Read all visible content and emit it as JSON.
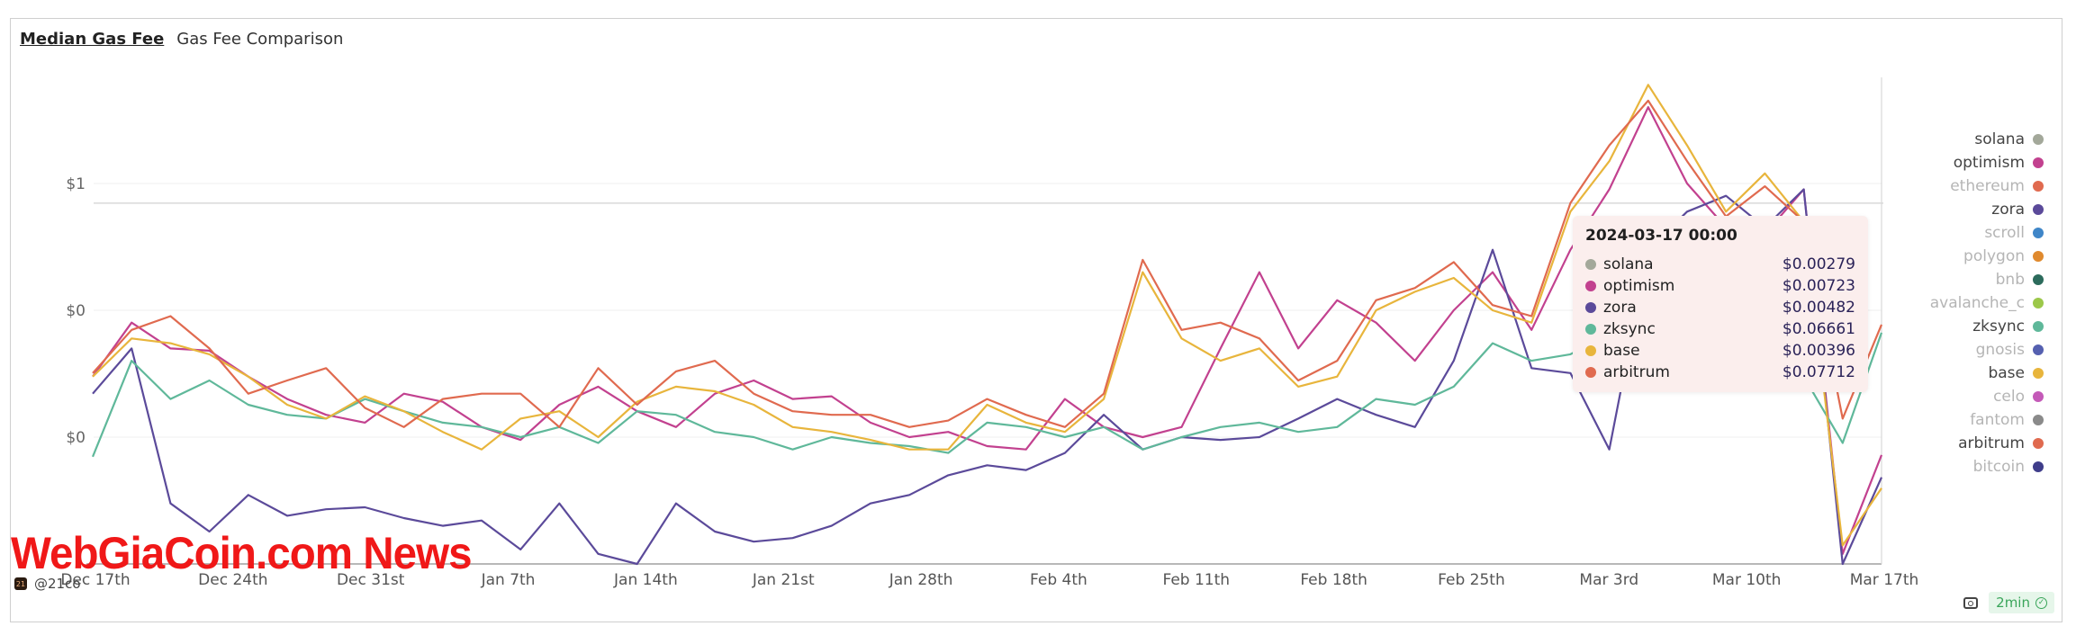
{
  "header": {
    "title": "Median Gas Fee",
    "subtitle": "Gas Fee Comparison"
  },
  "chart_data": {
    "type": "line",
    "title": "Median Gas Fee",
    "subtitle": "Gas Fee Comparison",
    "xlabel": "",
    "ylabel": "",
    "yscale": "log",
    "ylim": [
      0.001,
      6
    ],
    "y_ticks": [
      {
        "value": 1,
        "label": "$1"
      },
      {
        "value": 0.1,
        "label": "$0"
      },
      {
        "value": 0.01,
        "label": "$0"
      }
    ],
    "reference_line_value": 0.7,
    "x_ticks": [
      "Dec 17th",
      "Dec 24th",
      "Dec 31st",
      "Jan 7th",
      "Jan 14th",
      "Jan 21st",
      "Jan 28th",
      "Feb 4th",
      "Feb 11th",
      "Feb 18th",
      "Feb 25th",
      "Mar 3rd",
      "Mar 10th",
      "Mar 17th"
    ],
    "x_start": "2023-12-17",
    "x_end": "2024-03-17",
    "x_step_days": 2,
    "grid": true,
    "legend_position": "right",
    "series": [
      {
        "name": "optimism",
        "color": "#c2418f",
        "values": [
          0.03,
          0.08,
          0.05,
          0.048,
          0.03,
          0.02,
          0.015,
          0.013,
          0.022,
          0.019,
          0.012,
          0.0095,
          0.018,
          0.025,
          0.016,
          0.012,
          0.022,
          0.028,
          0.02,
          0.021,
          0.013,
          0.01,
          0.011,
          0.0085,
          0.008,
          0.02,
          0.012,
          0.01,
          0.012,
          0.05,
          0.2,
          0.05,
          0.12,
          0.08,
          0.04,
          0.1,
          0.2,
          0.07,
          0.3,
          0.9,
          4.0,
          1.0,
          0.45,
          0.4,
          0.9,
          0.0012,
          0.00723
        ]
      },
      {
        "name": "zora",
        "color": "#5b4a9a",
        "values": [
          0.022,
          0.05,
          0.003,
          0.0018,
          0.0035,
          0.0024,
          0.0027,
          0.0028,
          0.0023,
          0.002,
          0.0022,
          0.0013,
          0.003,
          0.0012,
          0.001,
          0.003,
          0.0018,
          0.0015,
          0.0016,
          0.002,
          0.003,
          0.0035,
          0.005,
          0.006,
          0.0055,
          0.0075,
          0.015,
          0.008,
          0.01,
          0.0095,
          0.01,
          0.014,
          0.02,
          0.015,
          0.012,
          0.04,
          0.3,
          0.035,
          0.032,
          0.008,
          0.3,
          0.6,
          0.8,
          0.45,
          0.9,
          0.001,
          0.00482
        ]
      },
      {
        "name": "zksync",
        "color": "#5fb89a",
        "values": [
          0.007,
          0.04,
          0.02,
          0.028,
          0.018,
          0.015,
          0.014,
          0.02,
          0.016,
          0.013,
          0.012,
          0.01,
          0.012,
          0.009,
          0.016,
          0.015,
          0.011,
          0.01,
          0.008,
          0.01,
          0.009,
          0.0085,
          0.0075,
          0.013,
          0.012,
          0.01,
          0.012,
          0.008,
          0.01,
          0.012,
          0.013,
          0.011,
          0.012,
          0.02,
          0.018,
          0.025,
          0.055,
          0.04,
          0.045,
          0.065,
          0.06,
          0.05,
          0.06,
          0.058,
          0.03,
          0.009,
          0.06661
        ]
      },
      {
        "name": "base",
        "color": "#e8b53c",
        "values": [
          0.03,
          0.06,
          0.055,
          0.045,
          0.03,
          0.018,
          0.014,
          0.021,
          0.016,
          0.011,
          0.008,
          0.014,
          0.016,
          0.01,
          0.019,
          0.025,
          0.023,
          0.018,
          0.012,
          0.011,
          0.0095,
          0.008,
          0.008,
          0.018,
          0.013,
          0.011,
          0.02,
          0.2,
          0.06,
          0.04,
          0.05,
          0.025,
          0.03,
          0.1,
          0.14,
          0.18,
          0.1,
          0.08,
          0.6,
          1.5,
          6.0,
          2.0,
          0.6,
          1.2,
          0.5,
          0.0014,
          0.00396
        ]
      },
      {
        "name": "arbitrum",
        "color": "#e06a4f",
        "values": [
          0.032,
          0.07,
          0.09,
          0.05,
          0.022,
          0.028,
          0.035,
          0.017,
          0.012,
          0.02,
          0.022,
          0.022,
          0.012,
          0.035,
          0.018,
          0.033,
          0.04,
          0.022,
          0.016,
          0.015,
          0.015,
          0.012,
          0.0135,
          0.02,
          0.015,
          0.012,
          0.022,
          0.25,
          0.07,
          0.08,
          0.06,
          0.028,
          0.04,
          0.12,
          0.15,
          0.24,
          0.11,
          0.09,
          0.7,
          2.0,
          4.5,
          1.5,
          0.55,
          0.95,
          0.5,
          0.014,
          0.07712
        ]
      }
    ],
    "tooltip": {
      "date": "2024-03-17 00:00",
      "rows": [
        {
          "name": "solana",
          "color": "#a3a89a",
          "value": "$0.00279"
        },
        {
          "name": "optimism",
          "color": "#c2418f",
          "value": "$0.00723"
        },
        {
          "name": "zora",
          "color": "#5b4a9a",
          "value": "$0.00482"
        },
        {
          "name": "zksync",
          "color": "#5fb89a",
          "value": "$0.06661"
        },
        {
          "name": "base",
          "color": "#e8b53c",
          "value": "$0.00396"
        },
        {
          "name": "arbitrum",
          "color": "#e06a4f",
          "value": "$0.07712"
        }
      ]
    },
    "legend": [
      {
        "name": "solana",
        "color": "#a3a89a",
        "active": true
      },
      {
        "name": "optimism",
        "color": "#c2418f",
        "active": true
      },
      {
        "name": "ethereum",
        "color": "#e06a4f",
        "active": false
      },
      {
        "name": "zora",
        "color": "#5b4a9a",
        "active": true
      },
      {
        "name": "scroll",
        "color": "#3f86c8",
        "active": false
      },
      {
        "name": "polygon",
        "color": "#e08a2e",
        "active": false
      },
      {
        "name": "bnb",
        "color": "#2c6b5c",
        "active": false
      },
      {
        "name": "avalanche_c",
        "color": "#9cc84a",
        "active": false
      },
      {
        "name": "zksync",
        "color": "#5fb89a",
        "active": true
      },
      {
        "name": "gnosis",
        "color": "#5560b0",
        "active": false
      },
      {
        "name": "base",
        "color": "#e8b53c",
        "active": true
      },
      {
        "name": "celo",
        "color": "#c45ab8",
        "active": false
      },
      {
        "name": "fantom",
        "color": "#8a8a8a",
        "active": false
      },
      {
        "name": "arbitrum",
        "color": "#e06a4f",
        "active": true
      },
      {
        "name": "bitcoin",
        "color": "#3f3d8a",
        "active": false
      }
    ]
  },
  "footer": {
    "author": "@21co",
    "refresh_badge": "2min"
  },
  "watermark": "WebGiaCoin.com News"
}
